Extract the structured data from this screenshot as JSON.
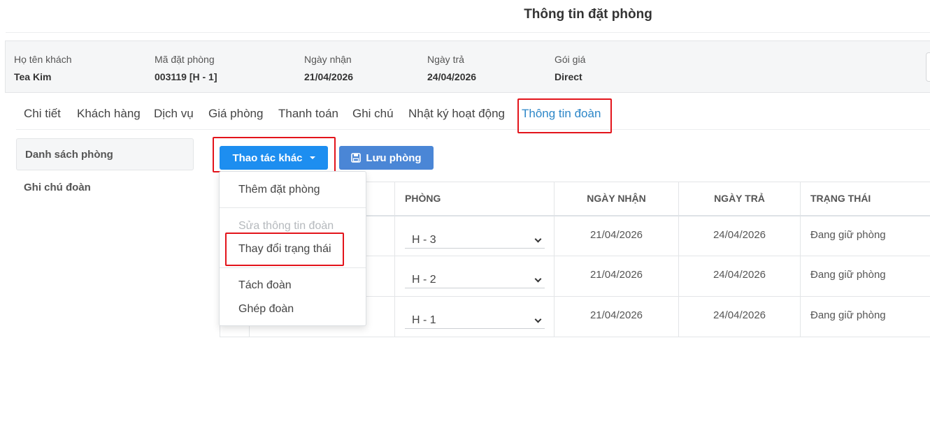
{
  "page": {
    "title": "Thông tin đặt phòng"
  },
  "booking": {
    "guest_label": "Họ tên khách",
    "guest_value": "Tea Kim",
    "code_label": "Mã đặt phòng",
    "code_value": "003119 [H - 1]",
    "checkin_label": "Ngày nhận",
    "checkin_value": "21/04/2026",
    "checkout_label": "Ngày trả",
    "checkout_value": "24/04/2026",
    "rate_label": "Gói giá",
    "rate_value": "Direct"
  },
  "tabs": [
    {
      "label": "Chi tiết"
    },
    {
      "label": "Khách hàng"
    },
    {
      "label": "Dịch vụ"
    },
    {
      "label": "Giá phòng"
    },
    {
      "label": "Thanh toán"
    },
    {
      "label": "Ghi chú"
    },
    {
      "label": "Nhật ký hoạt động"
    },
    {
      "label": "Thông tin đoàn",
      "active": true
    }
  ],
  "sidebar": {
    "items": [
      {
        "label": "Danh sách phòng",
        "active": true
      },
      {
        "label": "Ghi chú đoàn"
      }
    ]
  },
  "toolbar": {
    "more_actions_label": "Thao tác khác",
    "save_room_label": "Lưu phòng"
  },
  "dropdown": {
    "items": [
      {
        "label": "Thêm đặt phòng"
      },
      {
        "label": "Sửa thông tin đoàn",
        "disabled": true
      },
      {
        "label": "Thay đổi trạng thái"
      },
      {
        "label": "Tách đoàn"
      },
      {
        "label": "Ghép đoàn"
      }
    ]
  },
  "table": {
    "headers": {
      "room": "PHÒNG",
      "checkin": "NGÀY NHẬN",
      "checkout": "NGÀY TRẢ",
      "status": "TRẠNG THÁI"
    },
    "rows": [
      {
        "room": "H - 3",
        "checkin": "21/04/2026",
        "checkout": "24/04/2026",
        "status": "Đang giữ phòng"
      },
      {
        "room": "H - 2",
        "checkin": "21/04/2026",
        "checkout": "24/04/2026",
        "status": "Đang giữ phòng"
      },
      {
        "room": "H - 1",
        "checkin": "21/04/2026",
        "checkout": "24/04/2026",
        "status": "Đang giữ phòng"
      }
    ]
  },
  "colors": {
    "primary": "#1d8ef0",
    "save": "#4a86d6",
    "active_tab": "#2d87c8",
    "highlight": "#e3141b"
  }
}
